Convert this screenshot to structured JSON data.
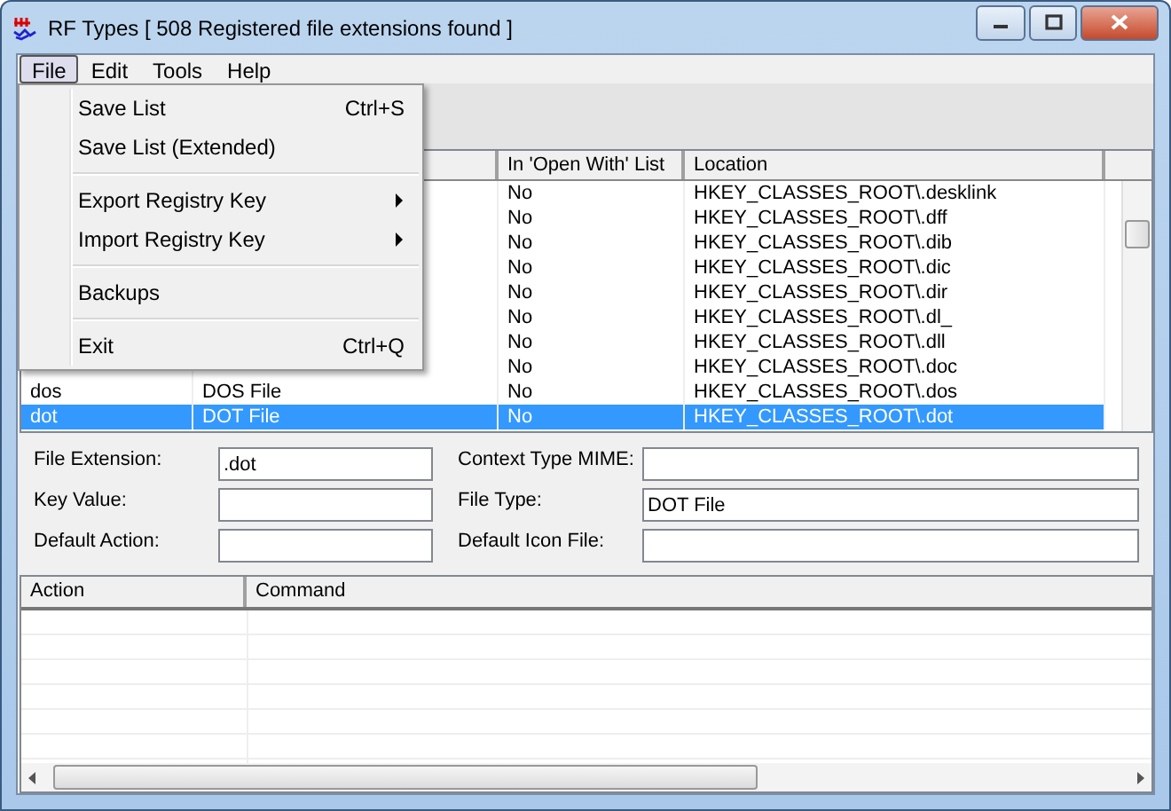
{
  "window": {
    "title": "RF Types [ 508 Registered file extensions found ]"
  },
  "menubar": [
    {
      "label": "File",
      "selected": true
    },
    {
      "label": "Edit",
      "selected": false
    },
    {
      "label": "Tools",
      "selected": false
    },
    {
      "label": "Help",
      "selected": false
    }
  ],
  "file_menu": [
    {
      "kind": "item",
      "label": "Save List",
      "shortcut": "Ctrl+S"
    },
    {
      "kind": "item",
      "label": "Save List (Extended)"
    },
    {
      "kind": "separator"
    },
    {
      "kind": "submenu",
      "label": "Export Registry Key"
    },
    {
      "kind": "submenu",
      "label": "Import Registry Key"
    },
    {
      "kind": "separator"
    },
    {
      "kind": "item",
      "label": "Backups"
    },
    {
      "kind": "separator"
    },
    {
      "kind": "item",
      "label": "Exit",
      "shortcut": "Ctrl+Q"
    }
  ],
  "table": {
    "columns": [
      "In 'Open With' List",
      "Location"
    ],
    "rows": [
      {
        "in_open_with": "No",
        "location": "HKEY_CLASSES_ROOT\\.desklink",
        "selected": false
      },
      {
        "in_open_with": "No",
        "location": "HKEY_CLASSES_ROOT\\.dff",
        "selected": false
      },
      {
        "in_open_with": "No",
        "location": "HKEY_CLASSES_ROOT\\.dib",
        "selected": false
      },
      {
        "in_open_with": "No",
        "location": "HKEY_CLASSES_ROOT\\.dic",
        "selected": false
      },
      {
        "in_open_with": "No",
        "location": "HKEY_CLASSES_ROOT\\.dir",
        "selected": false
      },
      {
        "in_open_with": "No",
        "location": "HKEY_CLASSES_ROOT\\.dl_",
        "selected": false
      },
      {
        "in_open_with": "No",
        "location": "HKEY_CLASSES_ROOT\\.dll",
        "selected": false
      },
      {
        "in_open_with": "No",
        "location": "HKEY_CLASSES_ROOT\\.doc",
        "selected": false
      },
      {
        "extension": "dos",
        "file_type": "DOS File",
        "in_open_with": "No",
        "location": "HKEY_CLASSES_ROOT\\.dos",
        "selected": false
      },
      {
        "extension": "dot",
        "file_type": "DOT File",
        "in_open_with": "No",
        "location": "HKEY_CLASSES_ROOT\\.dot",
        "selected": true
      }
    ]
  },
  "form": [
    {
      "label": "File Extension:",
      "value": ".dot"
    },
    {
      "label": "Context Type MIME:"
    },
    {
      "label": "Key Value:"
    },
    {
      "label": "File Type:",
      "value": "DOT File"
    },
    {
      "label": "Default Action:"
    },
    {
      "label": "Default Icon File:"
    }
  ],
  "actions_table": {
    "columns": [
      "Action",
      "Command"
    ]
  }
}
